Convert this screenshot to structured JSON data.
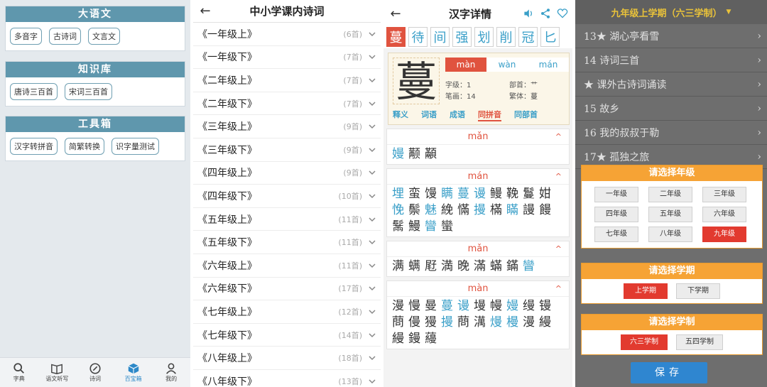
{
  "panel1": {
    "sections": [
      {
        "title": "大语文",
        "items": [
          "多音字",
          "古诗词",
          "文言文"
        ]
      },
      {
        "title": "知识库",
        "items": [
          "唐诗三百首",
          "宋词三百首"
        ]
      },
      {
        "title": "工具箱",
        "items": [
          "汉字转拼音",
          "简繁转换",
          "识字量测试"
        ]
      }
    ],
    "nav": [
      "字典",
      "语文听写",
      "诗词",
      "百宝箱",
      "我的"
    ]
  },
  "panel2": {
    "title": "中小学课内诗词",
    "rows": [
      {
        "name": "《一年级上》",
        "count": "(6首)"
      },
      {
        "name": "《一年级下》",
        "count": "(7首)"
      },
      {
        "name": "《二年级上》",
        "count": "(7首)"
      },
      {
        "name": "《二年级下》",
        "count": "(7首)"
      },
      {
        "name": "《三年级上》",
        "count": "(9首)"
      },
      {
        "name": "《三年级下》",
        "count": "(9首)"
      },
      {
        "name": "《四年级上》",
        "count": "(9首)"
      },
      {
        "name": "《四年级下》",
        "count": "(10首)"
      },
      {
        "name": "《五年级上》",
        "count": "(11首)"
      },
      {
        "name": "《五年级下》",
        "count": "(11首)"
      },
      {
        "name": "《六年级上》",
        "count": "(11首)"
      },
      {
        "name": "《六年级下》",
        "count": "(17首)"
      },
      {
        "name": "《七年级上》",
        "count": "(12首)"
      },
      {
        "name": "《七年级下》",
        "count": "(14首)"
      },
      {
        "name": "《八年级上》",
        "count": "(18首)"
      },
      {
        "name": "《八年级下》",
        "count": "(13首)"
      }
    ]
  },
  "panel3": {
    "title": "汉字详情",
    "tabs": [
      "蔓",
      "待",
      "间",
      "强",
      "划",
      "削",
      "冠",
      "匕"
    ],
    "char": "蔓",
    "pinyins": [
      "màn",
      "wàn",
      "mán"
    ],
    "info": {
      "grade": "字级：1",
      "radical": "部首：艹",
      "strokes": "笔画：14",
      "trad": "繁体：蔓"
    },
    "detail_tabs": [
      "释义",
      "词语",
      "成语",
      "同拼音",
      "同部首"
    ],
    "groups": [
      {
        "py": "mǎn",
        "chars": [
          "嫚",
          "颟",
          "顢"
        ],
        "hl": [
          0
        ]
      },
      {
        "py": "mán",
        "chars": [
          "埋",
          "蛮",
          "馒",
          "瞒",
          "蔓",
          "谩",
          "鳗",
          "鞔",
          "鬘",
          "姏",
          "悗",
          "鬃",
          "魅",
          "絻",
          "慲",
          "摱",
          "樠",
          "瞞",
          "謾",
          "饅",
          "鬗",
          "鰻",
          "矕",
          "蠻"
        ],
        "hl": [
          0,
          3,
          4,
          5,
          10,
          12,
          15,
          17,
          22
        ]
      },
      {
        "py": "mǎn",
        "chars": [
          "满",
          "螨",
          "屘",
          "満",
          "晚",
          "滿",
          "蟎",
          "鏋",
          "矕"
        ],
        "hl": [
          8
        ]
      },
      {
        "py": "màn",
        "chars": [
          "漫",
          "慢",
          "曼",
          "蔓",
          "谩",
          "墁",
          "幔",
          "嫚",
          "缦",
          "镘",
          "蔄",
          "僈",
          "獌",
          "摱",
          "蔄",
          "澫",
          "熳",
          "槾",
          "漫",
          "縵",
          "縵",
          "鏝",
          "蘰"
        ],
        "hl": [
          3,
          4,
          7,
          13,
          16,
          17
        ]
      }
    ]
  },
  "panel4": {
    "header": "九年级上学期（六三学制）",
    "lessons": [
      "13★ 湖心亭看雪",
      "14 诗词三首",
      "★ 课外古诗词诵读",
      "15 故乡",
      "16 我的叔叔于勒",
      "17★ 孤独之旅"
    ],
    "grade_title": "请选择年级",
    "grades": [
      "一年级",
      "二年级",
      "三年级",
      "四年级",
      "五年级",
      "六年级",
      "七年级",
      "八年级",
      "九年级"
    ],
    "term_title": "请选择学期",
    "terms": [
      "上学期",
      "下学期"
    ],
    "system_title": "请选择学制",
    "systems": [
      "六三学制",
      "五四学制"
    ],
    "save": "保存"
  },
  "colors": {
    "accent": "#e0533f",
    "teal": "#5f97ad",
    "blue": "#3a9fc8",
    "orange": "#f6a335",
    "save": "#2f86d0"
  }
}
